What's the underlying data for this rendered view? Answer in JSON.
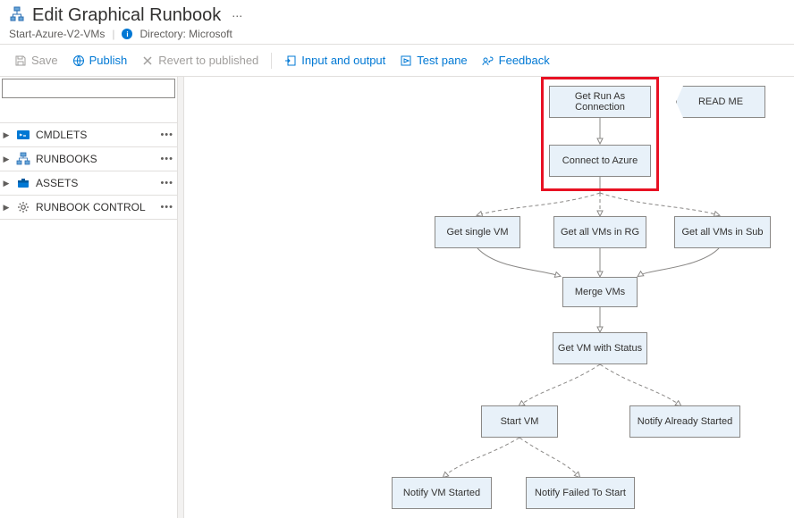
{
  "header": {
    "title": "Edit Graphical Runbook",
    "subtitle": "Start-Azure-V2-VMs",
    "directory_label": "Directory: Microsoft"
  },
  "toolbar": {
    "save": "Save",
    "publish": "Publish",
    "revert": "Revert to published",
    "input_output": "Input and output",
    "test_pane": "Test pane",
    "feedback": "Feedback"
  },
  "search": {
    "placeholder": ""
  },
  "sidebar": {
    "items": [
      {
        "label": "CMDLETS",
        "icon": "cmdlets"
      },
      {
        "label": "RUNBOOKS",
        "icon": "runbooks"
      },
      {
        "label": "ASSETS",
        "icon": "assets"
      },
      {
        "label": "RUNBOOK CONTROL",
        "icon": "control"
      }
    ]
  },
  "canvas": {
    "nodes": {
      "get_run_as": "Get Run As Connection",
      "connect_azure": "Connect to Azure",
      "read_me": "READ ME",
      "get_single_vm": "Get single VM",
      "get_all_vms_rg": "Get all VMs in RG",
      "get_all_vms_sub": "Get all VMs in Sub",
      "merge_vms": "Merge VMs",
      "get_vm_status": "Get VM with Status",
      "start_vm": "Start VM",
      "notify_already": "Notify Already Started",
      "notify_started": "Notify VM Started",
      "notify_failed": "Notify Failed To Start"
    }
  },
  "colors": {
    "node_bg": "#e8f1f9",
    "node_border": "#8a8886",
    "highlight": "#e81123",
    "link": "#0078d4"
  }
}
